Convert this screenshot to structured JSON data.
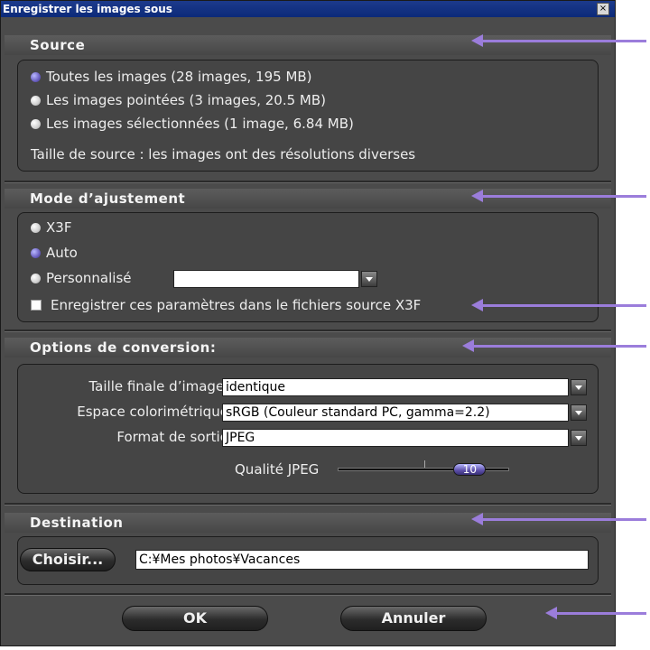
{
  "window": {
    "title": "Enregistrer les images sous",
    "close_glyph": "×"
  },
  "source": {
    "header": "Source",
    "options": [
      {
        "label": "Toutes les images (28 images, 195 MB)",
        "checked": true
      },
      {
        "label": "Les images pointées (3 images, 20.5 MB)",
        "checked": false
      },
      {
        "label": "Les images sélectionnées (1 image, 6.84 MB)",
        "checked": false
      }
    ],
    "info": "Taille de source : les images ont des résolutions diverses"
  },
  "adjust": {
    "header": "Mode d’ajustement",
    "options": [
      {
        "label": "X3F",
        "checked": false
      },
      {
        "label": "Auto",
        "checked": true
      },
      {
        "label": "Personnalisé",
        "checked": false
      }
    ],
    "custom_value": "",
    "save_checkbox_label": "Enregistrer ces paramètres dans le fichiers source X3F",
    "save_checked": false
  },
  "conversion": {
    "header": "Options de conversion:",
    "size_label": "Taille finale d’image :",
    "size_value": "identique",
    "color_label": "Espace colorimétrique:",
    "color_value": "sRGB (Couleur standard PC, gamma=2.2)",
    "format_label": "Format de sortie:",
    "format_value": "JPEG",
    "quality_label": "Qualité JPEG",
    "quality_value": "10",
    "quality_min": 0,
    "quality_max": 12
  },
  "destination": {
    "header": "Destination",
    "choose_label": "Choisir...",
    "path": "C:¥Mes photos¥Vacances"
  },
  "buttons": {
    "ok": "OK",
    "cancel": "Annuler"
  },
  "colors": {
    "background": "#4b4b4b",
    "accent": "#9b7ddb",
    "titlebar": "#1c3a8c"
  }
}
